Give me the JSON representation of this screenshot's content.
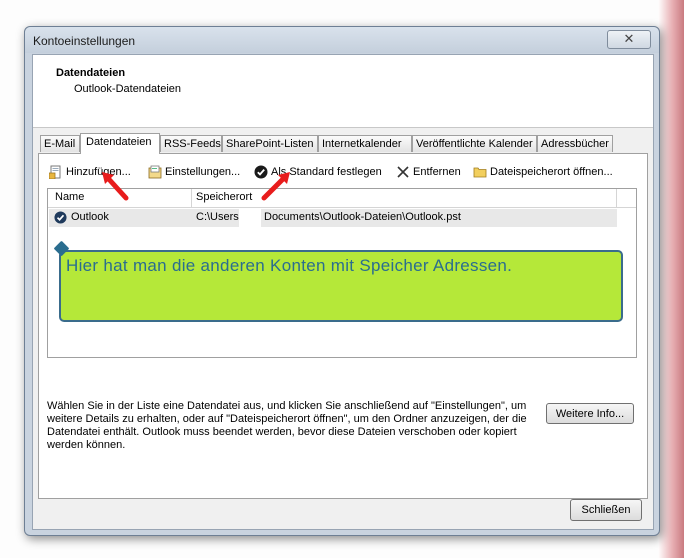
{
  "window": {
    "title": "Kontoeinstellungen",
    "close_glyph": "✕"
  },
  "header": {
    "title": "Datendateien",
    "subtitle": "Outlook-Datendateien"
  },
  "tabs": [
    {
      "label": "E-Mail",
      "active": false
    },
    {
      "label": "Datendateien",
      "active": true
    },
    {
      "label": "RSS-Feeds",
      "active": false
    },
    {
      "label": "SharePoint-Listen",
      "active": false
    },
    {
      "label": "Internetkalender",
      "active": false
    },
    {
      "label": "Veröffentlichte Kalender",
      "active": false
    },
    {
      "label": "Adressbücher",
      "active": false
    }
  ],
  "toolbar": {
    "add_label": "Hinzufügen...",
    "settings_label": "Einstellungen...",
    "default_label": "Als Standard festlegen",
    "remove_label": "Entfernen",
    "open_location_label": "Dateispeicherort öffnen..."
  },
  "list": {
    "columns": [
      "Name",
      "Speicherort"
    ],
    "rows": [
      {
        "name": "Outlook",
        "location_part1": "C:\\Users",
        "location_part2": "Documents\\Outlook-Dateien\\Outlook.pst"
      }
    ]
  },
  "annotation": {
    "text": "Hier hat man die anderen Konten mit Speicher Adressen.",
    "fill_color": "#b5e839",
    "text_color": "#2a6d8f"
  },
  "description": "Wählen Sie in der Liste eine Datendatei aus, und klicken Sie anschließend auf \"Einstellungen\", um weitere Details zu erhalten, oder auf \"Dateispeicherort öffnen\", um den Ordner anzuzeigen, der die Datendatei enthält. Outlook muss beendet werden, bevor diese Dateien verschoben oder kopiert werden können.",
  "buttons": {
    "more_info_label": "Weitere Info...",
    "close_label": "Schließen"
  },
  "colors": {
    "arrow": "#e81c1c",
    "window_frame": "#c9d3df"
  }
}
